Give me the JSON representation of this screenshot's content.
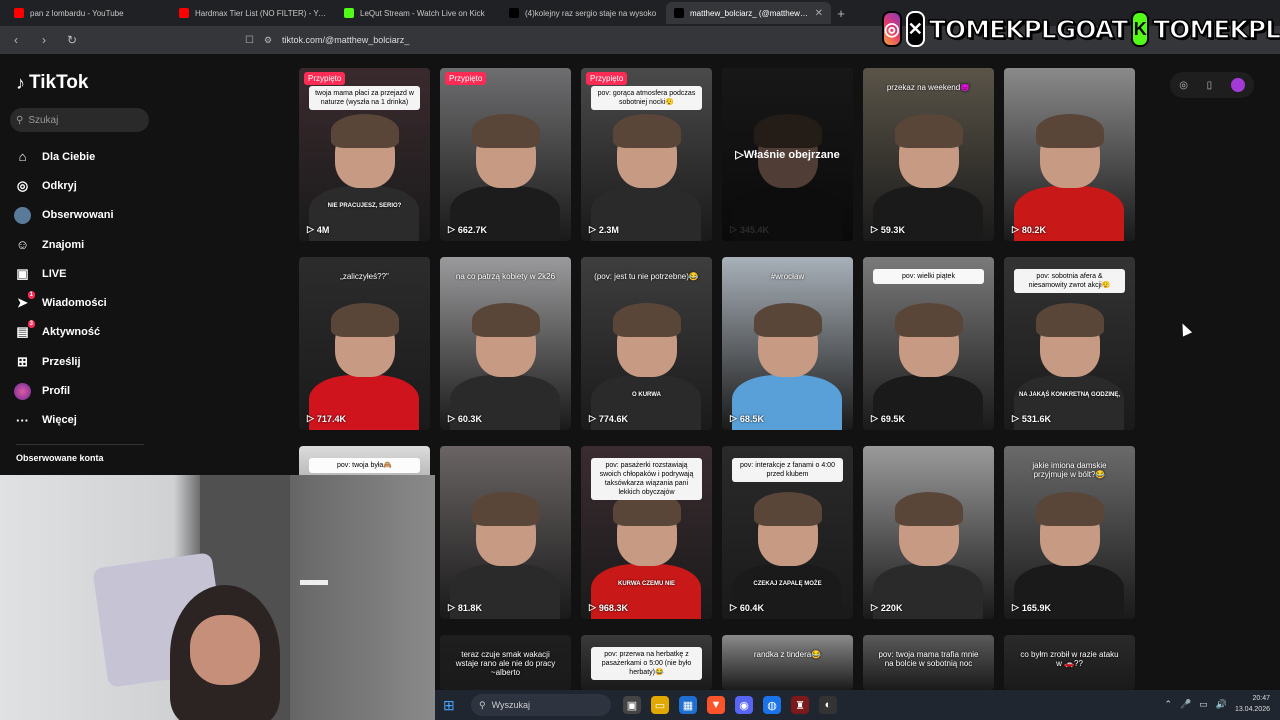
{
  "browser": {
    "tabs": [
      {
        "title": "pan z lombardu - YouTube",
        "color": "#ff0000",
        "active": false
      },
      {
        "title": "Hardmax Tier List (NO FILTER) - YouT",
        "color": "#ff0000",
        "active": false
      },
      {
        "title": "LeQut Stream - Watch Live on Kick",
        "color": "#53fc18",
        "active": false
      },
      {
        "title": "(4)kolejny raz sergio staje na wysoko",
        "color": "#000000",
        "active": false
      },
      {
        "title": "matthew_bolciarz_ (@matthew_b",
        "color": "#000000",
        "active": true
      }
    ],
    "new_tab": "+",
    "url": "tiktok.com/@matthew_bolciarz_"
  },
  "overlay": {
    "name1": "TOMEKPLGOAT",
    "name2": "TOMEKPL"
  },
  "sidebar": {
    "brand": "TikTok",
    "search_placeholder": "Szukaj",
    "items": [
      {
        "label": "Dla Ciebie",
        "icon": "home-icon",
        "glyph": "⌂"
      },
      {
        "label": "Odkryj",
        "icon": "compass-icon",
        "glyph": "◎"
      },
      {
        "label": "Obserwowani",
        "icon": "avatar-icon",
        "glyph": "●"
      },
      {
        "label": "Znajomi",
        "icon": "friends-icon",
        "glyph": "☺"
      },
      {
        "label": "LIVE",
        "icon": "live-icon",
        "glyph": "▣"
      },
      {
        "label": "Wiadomości",
        "icon": "messages-icon",
        "glyph": "➤",
        "badge": "1"
      },
      {
        "label": "Aktywność",
        "icon": "activity-icon",
        "glyph": "▤",
        "badge": "3"
      },
      {
        "label": "Prześlij",
        "icon": "upload-icon",
        "glyph": "⊞"
      },
      {
        "label": "Profil",
        "icon": "profile-icon",
        "glyph": "●"
      },
      {
        "label": "Więcej",
        "icon": "more-icon",
        "glyph": "···"
      }
    ],
    "followed_title": "Obserwowane konta"
  },
  "grid": {
    "pinned_label": "Przypięto",
    "watched_label": "Właśnie obejrzane",
    "videos": [
      {
        "views": "4M",
        "pinned": true,
        "caption": "twoja mama płaci za przejazd w naturze (wyszła na 1 drinka)",
        "lower": "NIE PRACUJESZ, SERIO?",
        "bg": "#3a2a2e",
        "shirt": "#2b2b2b"
      },
      {
        "views": "662.7K",
        "pinned": true,
        "caption": "",
        "lower": "",
        "bg": "#6e6e70",
        "shirt": "#1c1c1c"
      },
      {
        "views": "2.3M",
        "pinned": true,
        "caption": "pov: gorąca atmosfera podczas sobotniej nocki😮‍💨",
        "lower": "",
        "bg": "#4a4a4a",
        "shirt": "#2a2a2a"
      },
      {
        "views": "345.4K",
        "pinned": false,
        "caption": "",
        "lower": "",
        "bg": "#3c3c3c",
        "shirt": "#222",
        "watched": true
      },
      {
        "views": "59.3K",
        "pinned": false,
        "caption": "przekaz na weekend😈",
        "plain": true,
        "lower": "",
        "bg": "#5a5448",
        "shirt": "#1a1a1a"
      },
      {
        "views": "80.2K",
        "pinned": false,
        "caption": "",
        "lower": "",
        "bg": "#8a8a8a",
        "shirt": "#c81818"
      },
      {
        "views": "717.4K",
        "pinned": false,
        "caption": "„zaliczyłeś??\"",
        "plain": true,
        "lower": "",
        "bg": "#2c2c2c",
        "shirt": "#d0141e"
      },
      {
        "views": "60.3K",
        "pinned": false,
        "caption": "na co patrzą kobiety w 2k26",
        "plain": true,
        "lower": "",
        "bg": "#9a9a9c",
        "shirt": "#2a2a2a"
      },
      {
        "views": "774.6K",
        "pinned": false,
        "caption": "(pov: jest tu nie potrzebne)😂",
        "plain": true,
        "lower": "O KURWA",
        "bg": "#3e3e3e",
        "shirt": "#2a2a2a"
      },
      {
        "views": "68.5K",
        "pinned": false,
        "caption": "#wrocław",
        "plain": true,
        "lower": "",
        "bg": "#a8b0b8",
        "shirt": "#5aa0d8"
      },
      {
        "views": "69.5K",
        "pinned": false,
        "caption": "pov: wielki piątek",
        "lower": "",
        "bg": "#7a7a7a",
        "shirt": "#1a1a1a"
      },
      {
        "views": "531.6K",
        "pinned": false,
        "caption": "pov: sobotnia afera & niesamowity zwrot akcji😮‍💨",
        "lower": "NA JAKĄŚ KONKRETNĄ GODZINĘ,",
        "bg": "#333",
        "shirt": "#2a2a2a"
      },
      {
        "views": "",
        "pinned": false,
        "caption": "pov: twoja była🙈",
        "lower": "",
        "bg": "#dcdcdc",
        "shirt": "#2a2a2a"
      },
      {
        "views": "81.8K",
        "pinned": false,
        "caption": "",
        "lower": "",
        "bg": "#6a6464",
        "shirt": "#2a2a2a"
      },
      {
        "views": "968.3K",
        "pinned": false,
        "caption": "pov: pasażerki rozstawiają swoich chłopaków i podrywają taksówkarza wiązania pani lekkich obyczajów",
        "lower": "KURWA CZEMU NIE",
        "bg": "#3a2c30",
        "shirt": "#c81818"
      },
      {
        "views": "60.4K",
        "pinned": false,
        "caption": "pov: interakcje z fanami o 4:00 przed klubem",
        "lower": "CZEKAJ ZAPALĘ MOŻE",
        "bg": "#2a2a2a",
        "shirt": "#1a1a1a"
      },
      {
        "views": "220K",
        "pinned": false,
        "caption": "",
        "lower": "",
        "bg": "#9a9a9a",
        "shirt": "#2a2a2a"
      },
      {
        "views": "165.9K",
        "pinned": false,
        "caption": "jakie imiona damskie przyjmuje w bólt?😂",
        "plain": true,
        "lower": "",
        "bg": "#6a6a6a",
        "shirt": "#1a1a1a"
      },
      {
        "views": "",
        "pinned": false,
        "caption": "",
        "lower": "",
        "bg": "#333",
        "shirt": "#222"
      },
      {
        "views": "",
        "pinned": false,
        "caption": "teraz czuje smak wakacji wstaje rano ale nie do pracy ~alberto",
        "plain": true,
        "lower": "",
        "bg": "#1e1e1e",
        "shirt": "#222"
      },
      {
        "views": "",
        "pinned": false,
        "caption": "pov: przerwa na herbatkę z pasażerkami o 5:00 (nie było herbaty)😂",
        "lower": "",
        "bg": "#3a3a3a",
        "shirt": "#222"
      },
      {
        "views": "",
        "pinned": false,
        "caption": "randka z tindera😂",
        "plain": true,
        "lower": "",
        "bg": "#8a8a8a",
        "shirt": "#222"
      },
      {
        "views": "",
        "pinned": false,
        "caption": "pov: twoja mama trafia mnie na bolcie w sobotnią noc",
        "plain": true,
        "lower": "",
        "bg": "#5a5a5a",
        "shirt": "#222"
      },
      {
        "views": "",
        "pinned": false,
        "caption": "co byłm zrobił w razie ataku w 🚗??",
        "plain": true,
        "lower": "",
        "bg": "#2a2a2a",
        "shirt": "#222"
      }
    ]
  },
  "taskbar": {
    "search_placeholder": "Wyszukaj",
    "time": "20:47",
    "date": "13.04.2026"
  }
}
